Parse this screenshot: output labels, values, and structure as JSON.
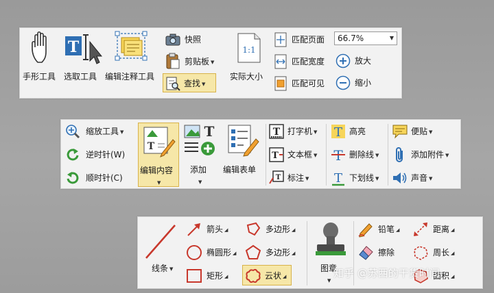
{
  "toolbar1": {
    "hand_tool": "手形工具",
    "select_tool": "选取工具",
    "edit_annot_tool": "编辑注释工具",
    "snapshot": "快照",
    "clipboard": "剪贴板",
    "find": "查找",
    "actual_size": "实际大小",
    "fit_page": "匹配页面",
    "fit_width": "匹配宽度",
    "fit_visible": "匹配可见",
    "zoom_value": "66.7%",
    "zoom_in": "放大",
    "zoom_out": "缩小"
  },
  "toolbar2": {
    "zoom_tool": "缩放工具",
    "rotate_ccw": "逆时针(W)",
    "rotate_cw": "顺时针(C)",
    "edit_content": "编辑内容",
    "add": "添加",
    "edit_form": "编辑表单",
    "typewriter": "打字机",
    "textbox": "文本框",
    "callout": "标注",
    "highlight": "高亮",
    "strikeout": "删除线",
    "underline": "下划线",
    "note": "便贴",
    "attach": "添加附件",
    "sound": "声音"
  },
  "toolbar3": {
    "line": "线条",
    "arrow": "箭头",
    "ellipse": "椭圆形",
    "rectangle": "矩形",
    "polygon": "多边形",
    "polyline": "多边形",
    "cloud": "云状",
    "stamp": "图章",
    "pencil": "铅笔",
    "eraser": "擦除",
    "distance": "距离",
    "perimeter": "周长",
    "area": "面积"
  },
  "watermark": "知乎 @苏西的干货时间",
  "colors": {
    "selected_bg": "#f6e7a8",
    "selected_border": "#d7b24a",
    "icon_blue": "#2f6fb3",
    "icon_green": "#3a9a3a",
    "icon_red": "#c8382c"
  }
}
